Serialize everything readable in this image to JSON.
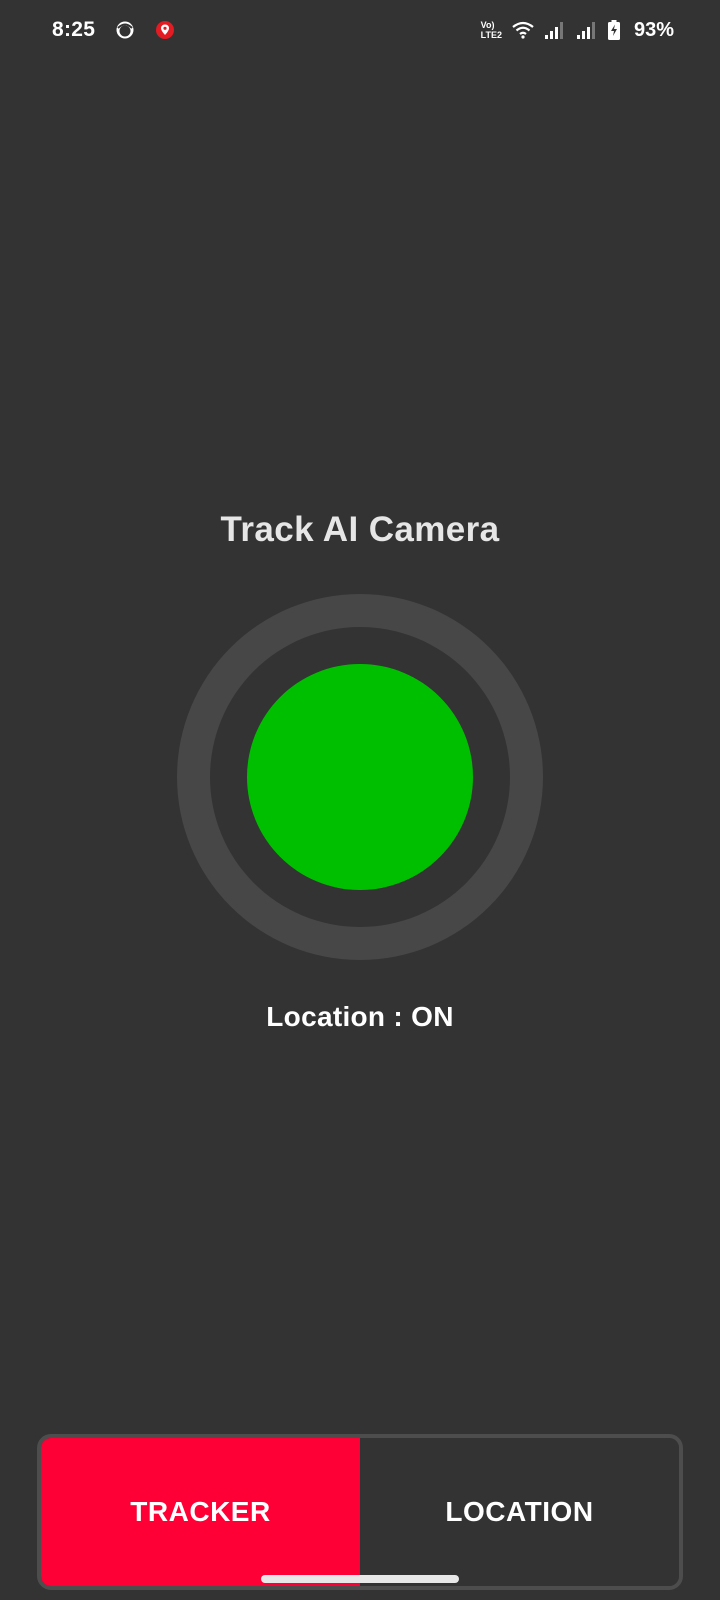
{
  "status_bar": {
    "time": "8:25",
    "notification_icons": [
      "face-icon",
      "location-pin-icon"
    ],
    "volte_line1": "Vo)",
    "volte_line2": "LTE2",
    "battery_percent": "93%"
  },
  "main": {
    "title": "Track AI Camera",
    "indicator_color": "#00bf00",
    "location_status": "Location : ON"
  },
  "bottom_nav": {
    "tabs": [
      {
        "label": "TRACKER",
        "active": true
      },
      {
        "label": "LOCATION",
        "active": false
      }
    ],
    "active_color": "#ff0036"
  }
}
